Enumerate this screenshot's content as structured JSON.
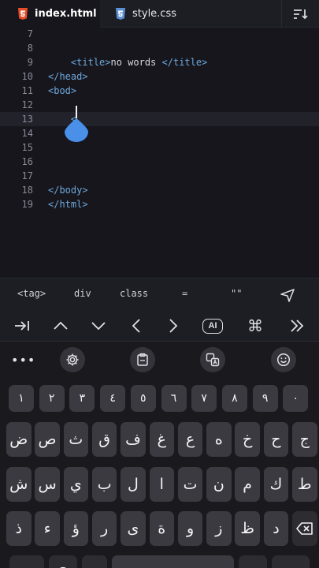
{
  "tabs": [
    {
      "label": "index.html",
      "icon": "html5-icon",
      "active": true
    },
    {
      "label": "style.css",
      "icon": "css3-icon",
      "active": false
    }
  ],
  "editor": {
    "lines": [
      {
        "n": "7",
        "code": ""
      },
      {
        "n": "8",
        "code": ""
      },
      {
        "n": "9",
        "code": "    <title>no words </title>"
      },
      {
        "n": "10",
        "code": "</head>"
      },
      {
        "n": "11",
        "code": "<bod>"
      },
      {
        "n": "12",
        "code": ""
      },
      {
        "n": "13",
        "code": "    <"
      },
      {
        "n": "14",
        "code": ""
      },
      {
        "n": "15",
        "code": ""
      },
      {
        "n": "16",
        "code": ""
      },
      {
        "n": "17",
        "code": ""
      },
      {
        "n": "18",
        "code": "</body>"
      },
      {
        "n": "19",
        "code": "</html>"
      }
    ],
    "current_line": "13"
  },
  "snippets": [
    "<tag>",
    "div",
    "class",
    "=",
    "\"\""
  ],
  "toolbar": {
    "ai_label": "AI"
  },
  "keyboard": {
    "digits": [
      "١",
      "٢",
      "٣",
      "٤",
      "٥",
      "٦",
      "٧",
      "٨",
      "٩",
      "٠"
    ],
    "row1": [
      "ض",
      "ص",
      "ث",
      "ق",
      "ف",
      "غ",
      "ع",
      "ه",
      "خ",
      "ح",
      "ج"
    ],
    "row2": [
      "ش",
      "س",
      "ي",
      "ب",
      "ل",
      "ا",
      "ت",
      "ن",
      "م",
      "ك",
      "ط"
    ],
    "row3": [
      "ذ",
      "ء",
      "ؤ",
      "ر",
      "ى",
      "ة",
      "و",
      "ز",
      "ظ",
      "د"
    ]
  },
  "colors": {
    "accent_drop": "#4a8fe8",
    "tag": "#6fa8dc",
    "background": "#16161c"
  }
}
